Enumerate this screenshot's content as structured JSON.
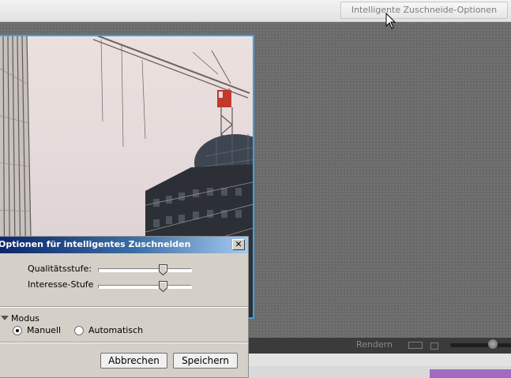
{
  "toolbar": {
    "smart_crop_options_button": "Intelligente Zuschneide-Optionen"
  },
  "timeline": {
    "render_label": "Rendern"
  },
  "dialog": {
    "title": "Optionen für intelligentes Zuschneiden",
    "close_glyph": "✕",
    "quality_label": "Qualitätsstufe:",
    "quality_value_pct": 73,
    "interest_label": "Interesse-Stufe",
    "interest_value_pct": 73,
    "mode_section_label": "Modus",
    "mode_options": [
      {
        "label": "Manuell",
        "selected": true
      },
      {
        "label": "Automatisch",
        "selected": false
      }
    ],
    "cancel_label": "Abbrechen",
    "save_label": "Speichern"
  },
  "colors": {
    "selection_border": "#3aa0e8",
    "title_gradient_start": "#0a246a",
    "title_gradient_end": "#a6caf0",
    "purple_clip": "#a06cc1"
  },
  "icons": [
    "mouse-pointer-icon",
    "close-icon",
    "collapse-triangle-icon",
    "fullscreen-icon",
    "square-icon",
    "zoom-slider-thumb"
  ]
}
